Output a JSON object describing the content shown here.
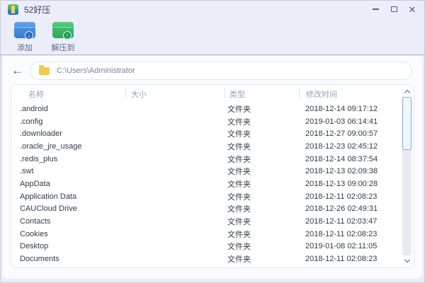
{
  "window": {
    "title": "52好压",
    "controls": {
      "minimize": "",
      "maximize": "",
      "close": "✕"
    }
  },
  "toolbar": {
    "buttons": [
      {
        "label": "添加",
        "icon": "archive-add-icon",
        "arrow": "↓",
        "color": "#4a90e0"
      },
      {
        "label": "解压到",
        "icon": "archive-extract-icon",
        "arrow": "↑",
        "color": "#3dbb6c"
      }
    ]
  },
  "address": {
    "back_icon": "←",
    "path": "C:\\Users\\Administrator"
  },
  "table": {
    "columns": [
      "名称",
      "大小",
      "类型",
      "修改时间"
    ],
    "rows": [
      {
        "name": ".android",
        "size": "",
        "type": "文件夹",
        "modified": "2018-12-14 09:17:12"
      },
      {
        "name": ".config",
        "size": "",
        "type": "文件夹",
        "modified": "2019-01-03 06:14:41"
      },
      {
        "name": ".downloader",
        "size": "",
        "type": "文件夹",
        "modified": "2018-12-27 09:00:57"
      },
      {
        "name": ".oracle_jre_usage",
        "size": "",
        "type": "文件夹",
        "modified": "2018-12-23 02:45:12"
      },
      {
        "name": ".redis_plus",
        "size": "",
        "type": "文件夹",
        "modified": "2018-12-14 08:37:54"
      },
      {
        "name": ".swt",
        "size": "",
        "type": "文件夹",
        "modified": "2018-12-13 02:09:38"
      },
      {
        "name": "AppData",
        "size": "",
        "type": "文件夹",
        "modified": "2018-12-13 09:00:28"
      },
      {
        "name": "Application Data",
        "size": "",
        "type": "文件夹",
        "modified": "2018-12-11 02:08:23"
      },
      {
        "name": "CAUCloud Drive",
        "size": "",
        "type": "文件夹",
        "modified": "2018-12-26 02:49:31"
      },
      {
        "name": "Contacts",
        "size": "",
        "type": "文件夹",
        "modified": "2018-12-11 02:03:47"
      },
      {
        "name": "Cookies",
        "size": "",
        "type": "文件夹",
        "modified": "2018-12-11 02:08:23"
      },
      {
        "name": "Desktop",
        "size": "",
        "type": "文件夹",
        "modified": "2019-01-08 02:11:05"
      },
      {
        "name": "Documents",
        "size": "",
        "type": "文件夹",
        "modified": "2018-12-11 02:08:23"
      }
    ]
  },
  "colors": {
    "frame_bg": "#ebedf8",
    "content_bg": "#fbfcff",
    "panel_border": "#e4e7f0",
    "header_text": "#99a1b3",
    "body_text": "#34394a",
    "toolbar_label": "#5b6b85",
    "add_icon_blue": "#4a90e0",
    "extract_icon_green": "#3dbb6c",
    "folder_yellow": "#f2c94c",
    "scroll_thumb_border": "#79a9dd"
  }
}
